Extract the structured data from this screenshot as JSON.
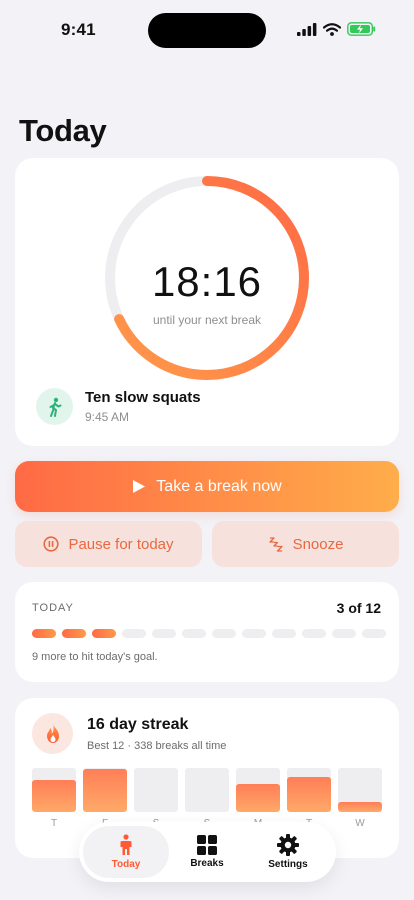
{
  "status_bar": {
    "time": "9:41"
  },
  "page": {
    "title": "Today"
  },
  "timer": {
    "value": "18:16",
    "caption": "until your next break",
    "progress": 0.68
  },
  "next_break": {
    "title": "Ten slow squats",
    "time": "9:45 AM",
    "icon": "walking-person-icon"
  },
  "actions": {
    "primary_label": "Take a break now",
    "pause_label": "Pause for today",
    "snooze_label": "Snooze"
  },
  "today": {
    "label": "TODAY",
    "count": "3 of 12",
    "done": 3,
    "total": 12,
    "note": "9 more to hit today's goal."
  },
  "streak": {
    "title": "16 day streak",
    "subtitle": "Best 12 · 338 breaks all time",
    "icon": "flame-icon",
    "days": [
      {
        "label": "T",
        "value": 0.72
      },
      {
        "label": "F",
        "value": 0.98
      },
      {
        "label": "S",
        "value": 0.0
      },
      {
        "label": "S",
        "value": 0.0
      },
      {
        "label": "M",
        "value": 0.64
      },
      {
        "label": "T",
        "value": 0.8
      },
      {
        "label": "W",
        "value": 0.22
      }
    ]
  },
  "tabs": [
    {
      "label": "Today",
      "icon": "person-icon",
      "active": true
    },
    {
      "label": "Breaks",
      "icon": "grid-icon",
      "active": false
    },
    {
      "label": "Settings",
      "icon": "gear-icon",
      "active": false
    }
  ],
  "colors": {
    "accent": "#FF6A45",
    "accent_end": "#FFAD4A",
    "secondary_bg": "#F6E1DD",
    "track": "#EEEEF0"
  }
}
